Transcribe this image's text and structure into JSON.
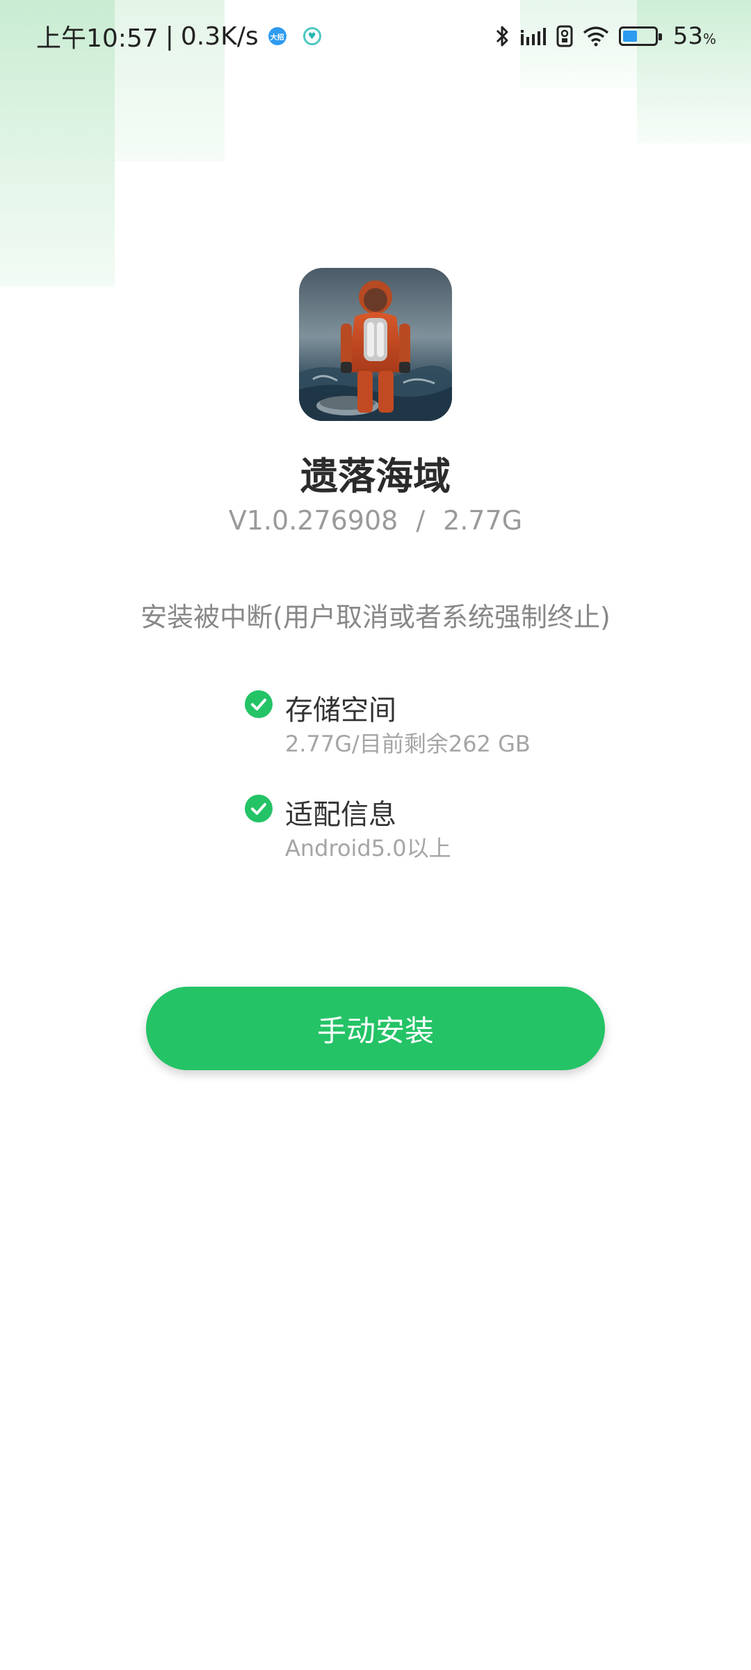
{
  "status_bar": {
    "time": "上午10:57",
    "separator": "|",
    "net_speed": "0.3K/s",
    "app_badge_text": "大招",
    "battery_level": 53,
    "battery_text": "53",
    "battery_unit": "%",
    "icons": [
      "bluetooth-icon",
      "signal-icon",
      "volte-icon",
      "wifi-icon",
      "battery-icon"
    ]
  },
  "app": {
    "name": "遗落海域",
    "version": "V1.0.276908",
    "meta_separator": "/",
    "size": "2.77G",
    "icon": "game-app-icon"
  },
  "install_status": "安装被中断(用户取消或者系统强制终止)",
  "checks": [
    {
      "title": "存储空间",
      "detail": "2.77G/目前剩余262 GB",
      "icon": "check-circle-icon"
    },
    {
      "title": "适配信息",
      "detail": "Android5.0以上",
      "icon": "check-circle-icon"
    }
  ],
  "actions": {
    "manual_install_label": "手动安装"
  },
  "colors": {
    "accent": "#24c366",
    "check": "#24c366",
    "title_text": "#2b2b2b",
    "secondary_text": "#9a9a9a",
    "battery_fill": "#2c9bf0"
  }
}
